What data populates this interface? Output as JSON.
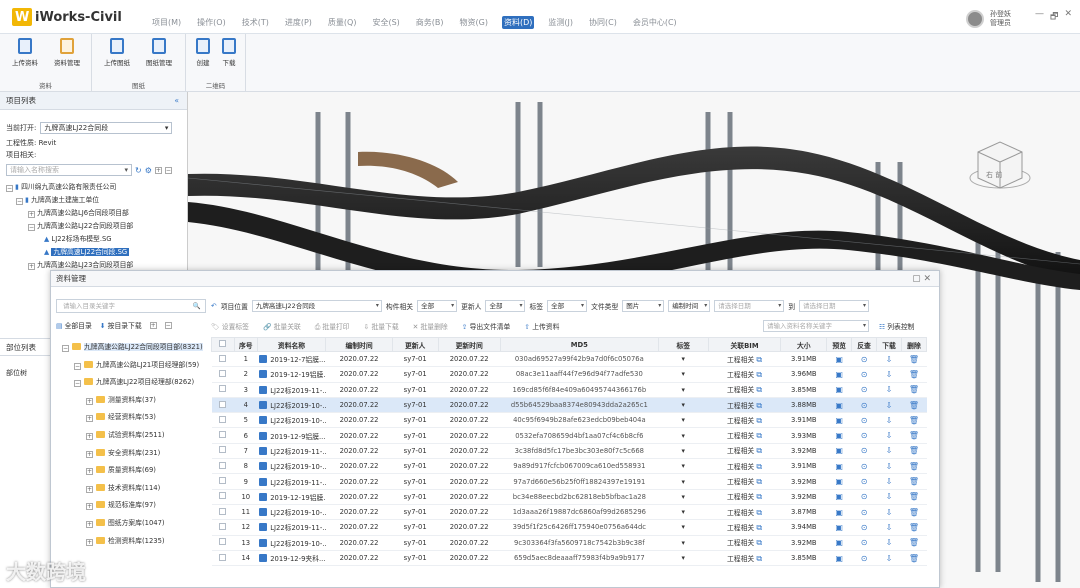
{
  "app": {
    "title": "iWorks-Civil"
  },
  "menu": [
    "项目(M)",
    "操作(O)",
    "技术(T)",
    "进度(P)",
    "质量(Q)",
    "安全(S)",
    "商务(B)",
    "物资(G)",
    "资料(D)",
    "监测(J)",
    "协同(C)",
    "会员中心(C)"
  ],
  "menu_active": 8,
  "user": {
    "name": "孙登妖",
    "role": "管理员"
  },
  "window_controls": [
    "—",
    "🗗",
    "✕"
  ],
  "ribbon": {
    "groups": [
      {
        "label": "资料",
        "buttons": [
          "上传资料",
          "资料管理"
        ]
      },
      {
        "label": "图纸",
        "buttons": [
          "上传图纸",
          "图纸管理"
        ]
      },
      {
        "label": "二维码",
        "buttons": [
          "创建",
          "下载"
        ]
      }
    ]
  },
  "project_panel": {
    "title": "项目列表",
    "collapse": "«",
    "current_label": "当前打开:",
    "current_value": "九牌高速LJ22合同段",
    "type_label": "工程性质:",
    "type_value": "Revit",
    "related_label": "项目相关:",
    "search_placeholder": "请输入名称搜索",
    "tree": [
      "四川绵九高速公路有限责任公司",
      "九牌高速土建施工单位",
      "九牌高速公路LJ6合同段项目部",
      "九牌高速公路LJ22合同段项目部",
      "LJ22标场布模型.SG",
      "九牌高速LJ22合同段.SG",
      "九牌高速公路LJ23合同段项目部"
    ],
    "section2": "部位列表",
    "section2_sub": "部位树"
  },
  "dialog": {
    "title": "资料管理",
    "search_placeholder": "请输入目录关键字",
    "all_dir": "全部目录",
    "by_dir_download": "按目录下载",
    "folders": [
      {
        "name": "九牌高速公路LJ22合同段项目部(8321)",
        "level": 0
      },
      {
        "name": "九牌高速公路LJ21项目经理部(59)",
        "level": 1
      },
      {
        "name": "九牌高速LJ22项目经理部(8262)",
        "level": 1
      },
      {
        "name": "测量资料库(37)",
        "level": 2
      },
      {
        "name": "经营资料库(53)",
        "level": 2
      },
      {
        "name": "试验资料库(2511)",
        "level": 2
      },
      {
        "name": "安全资料库(231)",
        "level": 2
      },
      {
        "name": "质量资料库(69)",
        "level": 2
      },
      {
        "name": "技术资料库(114)",
        "level": 2
      },
      {
        "name": "规范标准库(97)",
        "level": 2
      },
      {
        "name": "图纸方案库(1047)",
        "level": 2
      },
      {
        "name": "检测资料库(1235)",
        "level": 2
      }
    ],
    "filters": {
      "location_label": "项目位置",
      "location_value": "九牌高速LJ22合同段",
      "component_label": "构件相关",
      "component_value": "全部",
      "updater_label": "更新人",
      "updater_value": "全部",
      "tag_label": "标签",
      "tag_value": "全部",
      "filetype_label": "文件类型",
      "filetype_value": "图片",
      "time_value": "编制时间",
      "date_placeholder": "请选择日期",
      "to": "到",
      "keyword_placeholder": "请输入资料名称关键字",
      "col_ctrl": "列表控制"
    },
    "toolbar": [
      "设置标签",
      "批量关联",
      "批量打印",
      "批量下载",
      "批量删除",
      "导出文件清单",
      "上传资料"
    ],
    "columns": [
      "序号",
      "资料名称",
      "编制时间",
      "更新人",
      "更新时间",
      "MD5",
      "标签",
      "关联BIM",
      "大小",
      "预览",
      "反查",
      "下载",
      "删除"
    ],
    "rows": [
      {
        "n": "1",
        "name": "2019-12-7铝膜...",
        "date": "2020.07.22",
        "who": "sy7-01",
        "utime": "2020.07.22",
        "md5": "030ad69527a99f42b9a7d0f6c05076a",
        "bim": "工程相关",
        "size": "3.91MB"
      },
      {
        "n": "2",
        "name": "2019-12-19铝膜...",
        "date": "2020.07.22",
        "who": "sy7-01",
        "utime": "2020.07.22",
        "md5": "08ac3e11aaff44f7e96d94f77adfe530",
        "bim": "工程相关",
        "size": "3.96MB"
      },
      {
        "n": "3",
        "name": "LJ22标2019-11-...",
        "date": "2020.07.22",
        "who": "sy7-01",
        "utime": "2020.07.22",
        "md5": "169cd85f6f84e409a60495744366176b",
        "bim": "工程相关",
        "size": "3.85MB"
      },
      {
        "n": "4",
        "name": "LJ22标2019-10-...",
        "date": "2020.07.22",
        "who": "sy7-01",
        "utime": "2020.07.22",
        "md5": "d55b64529baa8374e80943dda2a265c1",
        "bim": "工程相关",
        "size": "3.88MB"
      },
      {
        "n": "5",
        "name": "LJ22标2019-10-...",
        "date": "2020.07.22",
        "who": "sy7-01",
        "utime": "2020.07.22",
        "md5": "40c95f6949b28afe623edcb09beb404a",
        "bim": "工程相关",
        "size": "3.91MB"
      },
      {
        "n": "6",
        "name": "2019-12-9铝膜...",
        "date": "2020.07.22",
        "who": "sy7-01",
        "utime": "2020.07.22",
        "md5": "0532efa708659d4bf1aa07cf4c6b8cf6",
        "bim": "工程相关",
        "size": "3.93MB"
      },
      {
        "n": "7",
        "name": "LJ22标2019-11-...",
        "date": "2020.07.22",
        "who": "sy7-01",
        "utime": "2020.07.22",
        "md5": "3c38fd8d5fc17be3bc303e80f7c5c668",
        "bim": "工程相关",
        "size": "3.92MB"
      },
      {
        "n": "8",
        "name": "LJ22标2019-10-...",
        "date": "2020.07.22",
        "who": "sy7-01",
        "utime": "2020.07.22",
        "md5": "9a89d917fcfcb067009ca610ed558931",
        "bim": "工程相关",
        "size": "3.91MB"
      },
      {
        "n": "9",
        "name": "LJ22标2019-11-...",
        "date": "2020.07.22",
        "who": "sy7-01",
        "utime": "2020.07.22",
        "md5": "97a7d660e56b25f0ff18824397e19191",
        "bim": "工程相关",
        "size": "3.92MB"
      },
      {
        "n": "10",
        "name": "2019-12-19铝膜...",
        "date": "2020.07.22",
        "who": "sy7-01",
        "utime": "2020.07.22",
        "md5": "bc34e88eecbd2bc62818eb5bfbac1a28",
        "bim": "工程相关",
        "size": "3.92MB"
      },
      {
        "n": "11",
        "name": "LJ22标2019-10-...",
        "date": "2020.07.22",
        "who": "sy7-01",
        "utime": "2020.07.22",
        "md5": "1d3aaa26f19887dc6860af99d2685296",
        "bim": "工程相关",
        "size": "3.87MB"
      },
      {
        "n": "12",
        "name": "LJ22标2019-11-...",
        "date": "2020.07.22",
        "who": "sy7-01",
        "utime": "2020.07.22",
        "md5": "39d5f1f25c6426ff175940e0756a644dc",
        "bim": "工程相关",
        "size": "3.94MB"
      },
      {
        "n": "13",
        "name": "LJ22标2019-10-...",
        "date": "2020.07.22",
        "who": "sy7-01",
        "utime": "2020.07.22",
        "md5": "9c303364f3fa5609718c7542b3b9c38f",
        "bim": "工程相关",
        "size": "3.92MB"
      },
      {
        "n": "14",
        "name": "2019-12-9夹科...",
        "date": "2020.07.22",
        "who": "sy7-01",
        "utime": "2020.07.22",
        "md5": "659d5aec8deaaaff75983f4b9a9b9177",
        "bim": "工程相关",
        "size": "3.85MB"
      }
    ],
    "selected_row": 3
  },
  "navcube": {
    "face": "右 前"
  },
  "colors": {
    "accent": "#2f6fbe",
    "folder": "#f4c04a",
    "logo": "#f2b705"
  }
}
